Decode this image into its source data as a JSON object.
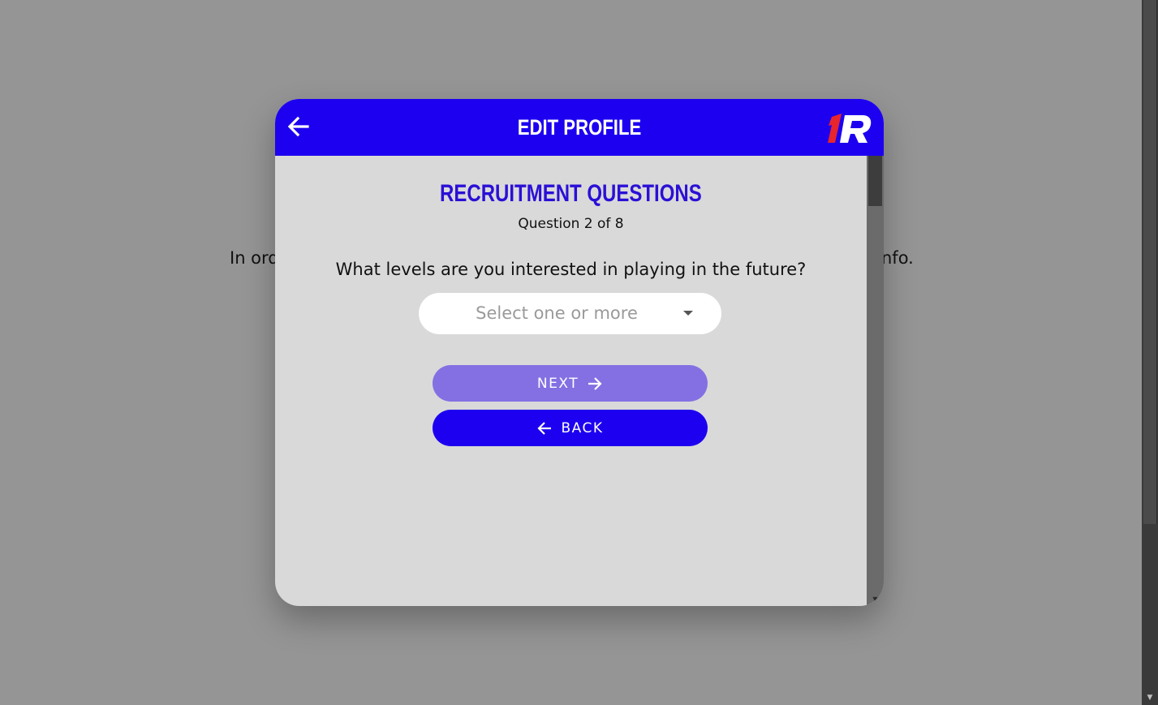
{
  "background": {
    "text_left": "In ord",
    "text_right": "nfo."
  },
  "modal": {
    "header": {
      "title": "EDIT PROFILE",
      "back_icon": "arrow-left-icon",
      "logo_text": "1R"
    },
    "section_title": "RECRUITMENT QUESTIONS",
    "question_count": "Question 2 of 8",
    "question_text": "What levels are you interested in playing in the future?",
    "select": {
      "placeholder": "Select one or more",
      "icon": "caret-down-icon"
    },
    "buttons": {
      "next_label": "NEXT",
      "back_label": "BACK"
    }
  },
  "colors": {
    "primary": "#1d00f0",
    "next_disabled": "#8470e3",
    "section_title": "#2a10d6",
    "modal_bg": "#d9d9d9",
    "overlay": "#959595",
    "logo_red": "#e8242c"
  }
}
